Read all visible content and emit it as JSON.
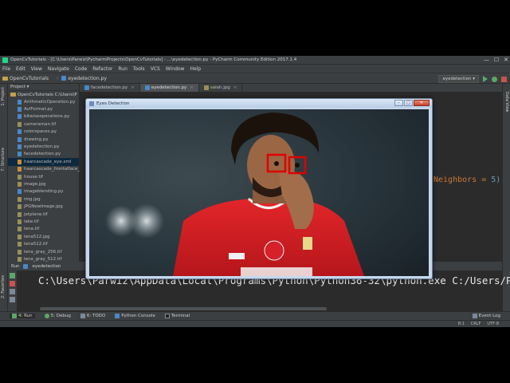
{
  "titlebar": {
    "title": "OpenCvTutorials - [C:\\Users\\Parwiz\\PycharmProjects\\OpenCvTutorials] - ...\\eyedetection.py - PyCharm Community Edition 2017.1.4",
    "minimize": "—",
    "maximize": "☐",
    "close": "✕"
  },
  "menu": [
    "File",
    "Edit",
    "View",
    "Navigate",
    "Code",
    "Refactor",
    "Run",
    "Tools",
    "VCS",
    "Window",
    "Help"
  ],
  "navbar": {
    "project": "OpenCvTutorials",
    "file": "eyedetection.py",
    "run_config": "eyedetection ▾"
  },
  "project_panel": {
    "header": "Project ▾",
    "root": "OpenCvTutorials  C:\\Users\\P",
    "files": [
      {
        "name": "ArithmeticOperation.py",
        "type": "py"
      },
      {
        "name": "AviFormat.py",
        "type": "py"
      },
      {
        "name": "bitwiseoperations.py",
        "type": "py"
      },
      {
        "name": "cameraman.tif",
        "type": "img"
      },
      {
        "name": "colorspaces.py",
        "type": "py"
      },
      {
        "name": "drawing.py",
        "type": "py"
      },
      {
        "name": "eyedetection.py",
        "type": "py"
      },
      {
        "name": "facedetection.py",
        "type": "py"
      },
      {
        "name": "haarcascade_eye.xml",
        "type": "xml"
      },
      {
        "name": "haarcascade_frontalface_",
        "type": "xml"
      },
      {
        "name": "house.tif",
        "type": "img"
      },
      {
        "name": "image.jpg",
        "type": "img"
      },
      {
        "name": "imageblending.py",
        "type": "py"
      },
      {
        "name": "img.jpg",
        "type": "img"
      },
      {
        "name": "JPGNewImage.jpg",
        "type": "img"
      },
      {
        "name": "jetplane.tif",
        "type": "img"
      },
      {
        "name": "lake.tif",
        "type": "img"
      },
      {
        "name": "lena.tif",
        "type": "img"
      },
      {
        "name": "lena512.jpg",
        "type": "img"
      },
      {
        "name": "lena512.tif",
        "type": "img"
      },
      {
        "name": "lena_gray_256.tif",
        "type": "img"
      },
      {
        "name": "lena_gray_512.tif",
        "type": "img"
      }
    ],
    "selected_index": 8
  },
  "editor_tabs": [
    {
      "label": "facedetection.py",
      "active": false
    },
    {
      "label": "eyedetection.py",
      "active": true
    },
    {
      "label": "salah.jpg",
      "active": false
    }
  ],
  "editor": {
    "code_fragment_text": "Neighbors = ",
    "code_fragment_number": "5)"
  },
  "cv_window": {
    "title": "Eyes Detection",
    "minimize": "–",
    "maximize": "□",
    "close": "✕"
  },
  "run_panel": {
    "label": "Run",
    "config": "eyedetection",
    "console_line": "C:\\Users\\Parwiz\\AppData\\Local\\Programs\\Python\\Python36-32\\python.exe C:/Users/Parwi"
  },
  "tool_windows": [
    {
      "label": "4: Run",
      "active": true
    },
    {
      "label": "5: Debug",
      "active": false
    },
    {
      "label": "6: TODO",
      "active": false
    },
    {
      "label": "Python Console",
      "active": false
    },
    {
      "label": "Terminal",
      "active": false
    }
  ],
  "event_log": "Event Log",
  "status": {
    "position": "8:1",
    "line_sep": "CRLF",
    "encoding": "UTF-8"
  },
  "side_tabs": {
    "project": "1: Project",
    "structure": "7: Structure",
    "favorites": "2: Favorites",
    "database": "Data View"
  },
  "colors": {
    "ide_bg": "#2b2b2b",
    "panel_bg": "#3c3f41",
    "detection_box": "#e00000",
    "jersey": "#d41c20"
  }
}
